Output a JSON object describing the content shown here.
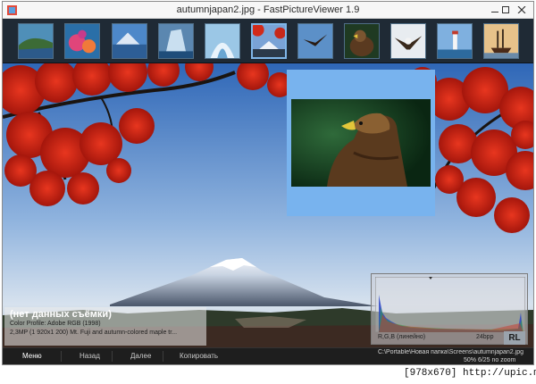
{
  "window": {
    "title": "autumnjapan2.jpg - FastPictureViewer 1.9"
  },
  "thumbnails": [
    {
      "name": "thumb-coast",
      "selected": false
    },
    {
      "name": "thumb-coral",
      "selected": false
    },
    {
      "name": "thumb-mountain-lake",
      "selected": false
    },
    {
      "name": "thumb-iceberg",
      "selected": false
    },
    {
      "name": "thumb-ice-cave",
      "selected": false
    },
    {
      "name": "thumb-autumnjapan2",
      "selected": true
    },
    {
      "name": "thumb-bird-flying",
      "selected": false
    },
    {
      "name": "thumb-eagle",
      "selected": false
    },
    {
      "name": "thumb-eagle-wings",
      "selected": false
    },
    {
      "name": "thumb-lighthouse",
      "selected": false
    },
    {
      "name": "thumb-ship",
      "selected": false
    }
  ],
  "exif": {
    "title": "(нет данных съёмки)",
    "color_profile": "Color Profile: Adobe RGB (1998)",
    "details": "2,3MP (1 920x1 200) Mt. Fuji and autumn-colored maple tr..."
  },
  "histogram": {
    "label": "R,G,B (линейно)",
    "bpp": "24bpp",
    "logo": "RL"
  },
  "statusbar": {
    "menu": [
      "Меню",
      "Назад",
      "Далее",
      "Копировать"
    ],
    "path": "C:\\Portable\\Новая папка\\Screens\\autumnjapan2.jpg",
    "info": "50%  6/25  no zoom"
  },
  "watermark": "[978x670] http://upic.me/",
  "colors": {
    "thumbstrip_bg": "#1f2a35",
    "preview_bg": "#78b3ee",
    "statusbar_bg": "#1e1e1e",
    "maple_red": "#d22a1a"
  }
}
